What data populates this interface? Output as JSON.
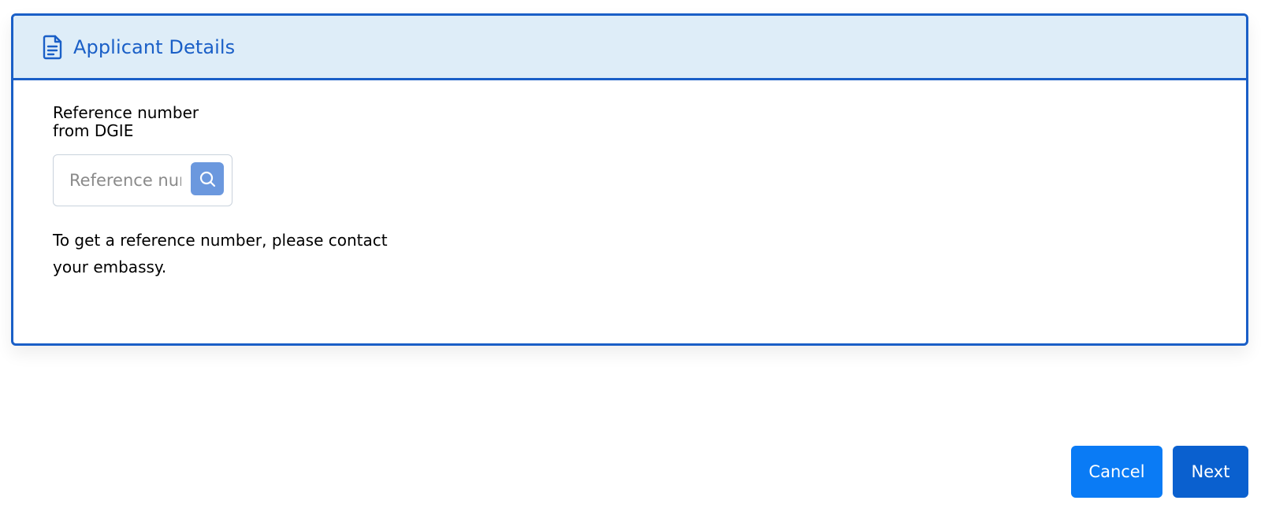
{
  "panel": {
    "title": "Applicant Details",
    "icon": "document-icon",
    "accent_color": "#1a5fc7",
    "header_bg": "#deedf8"
  },
  "reference": {
    "label": "Reference number from DGIE",
    "input_value": "",
    "placeholder": "Reference number",
    "search_icon": "search-icon",
    "help_text": "To get a reference number, please contact your embassy."
  },
  "actions": {
    "cancel_label": "Cancel",
    "next_label": "Next",
    "cancel_color": "#0a7bf5",
    "next_color": "#0a60cf"
  }
}
